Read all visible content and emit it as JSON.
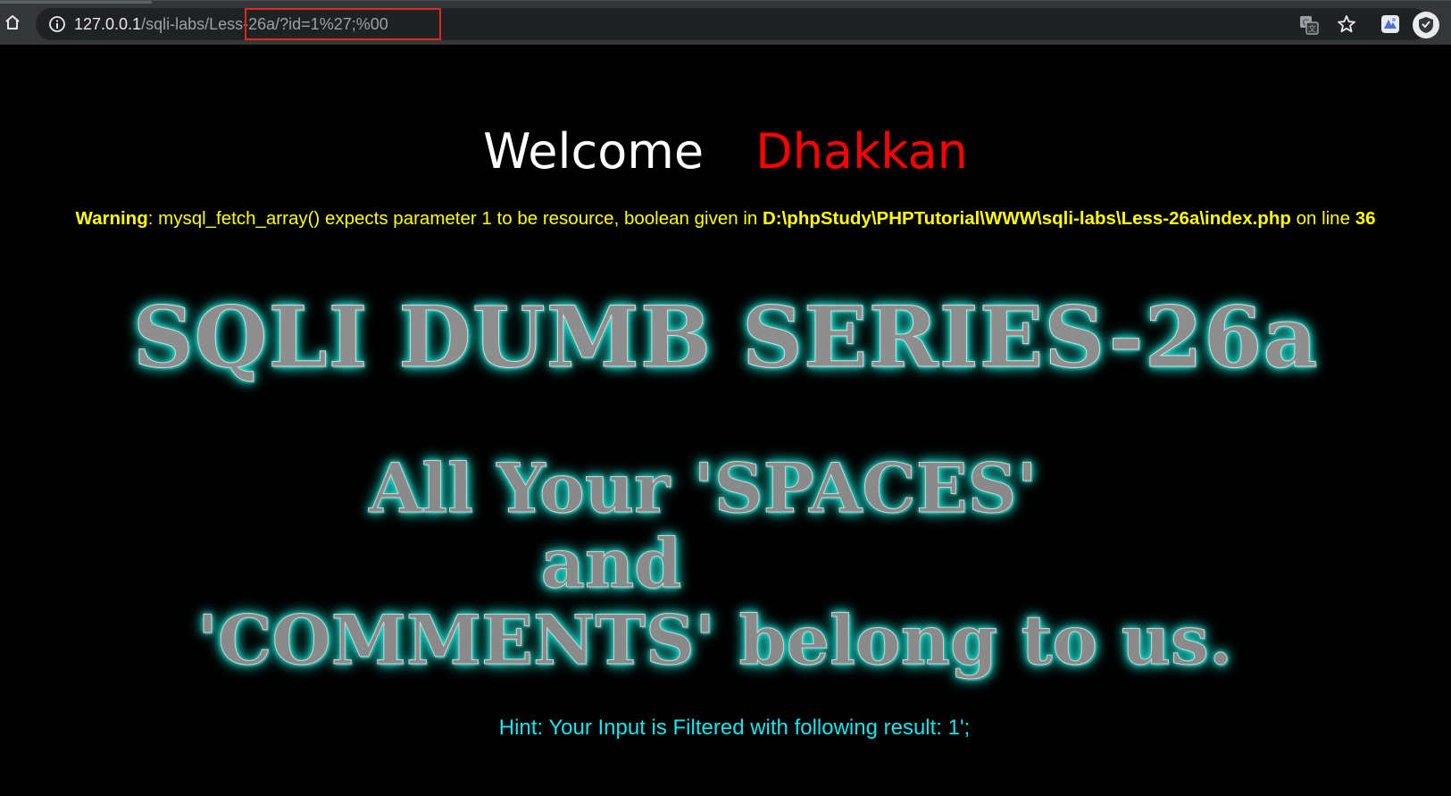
{
  "browser": {
    "url_host": "127.0.0.1",
    "url_path": "/sqli-labs/Less-26a/?id=1%27;%00",
    "highlight_color": "#e1281f",
    "icons": [
      "home-icon",
      "info-icon",
      "translate-icon",
      "star-icon",
      "extension-icon",
      "profile-avatar"
    ]
  },
  "page": {
    "welcome_word": "Welcome",
    "welcome_name": "Dhakkan",
    "warning": {
      "label": "Warning",
      "message": ": mysql_fetch_array() expects parameter 1 to be resource, boolean given in ",
      "file": "D:\\phpStudy\\PHPTutorial\\WWW\\sqli-labs\\Less-26a\\index.php",
      "line_text": " on line ",
      "line_number": "36"
    },
    "banner": {
      "title": "SQLI DUMB SERIES-26a",
      "line1": "All Your 'SPACES'",
      "line2": "and",
      "line3": "'COMMENTS' belong to us."
    },
    "hint": "Hint: Your Input is Filtered with following result: 1';"
  },
  "colors": {
    "background": "#000000",
    "welcome": "#ffffff",
    "name": "#ff0000",
    "warning": "#ffff00",
    "hint": "#17e6f0",
    "banner_glow": "#1fe0d2"
  }
}
